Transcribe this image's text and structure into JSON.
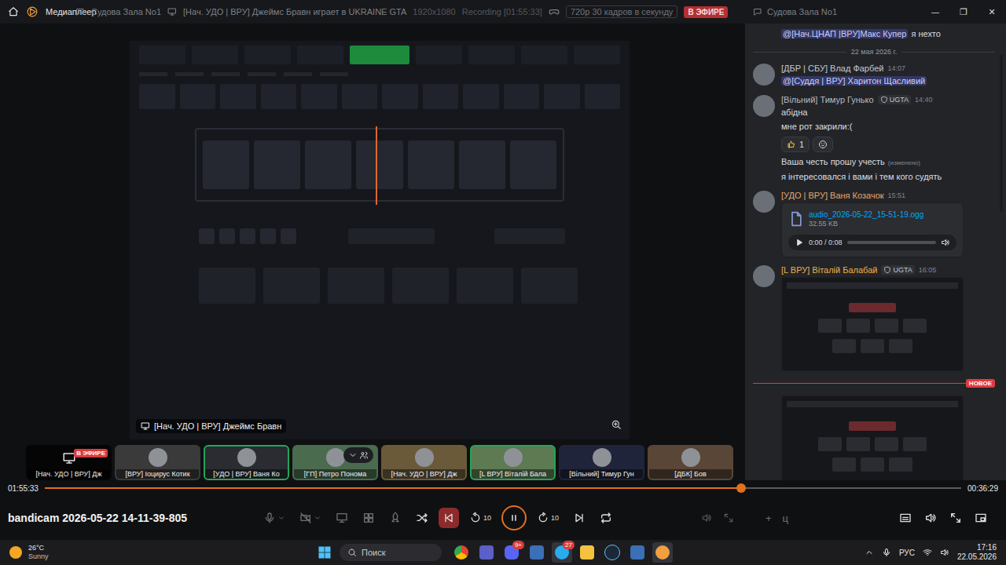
{
  "topbar": {
    "app_name": "Медиаплеер",
    "channel": "Судова Зала No1",
    "stream_title": "[Нач. УДО | ВРУ] Джеймс Бравн играет в UKRAINE GTA",
    "resolution": "1920x1080",
    "recording": "Recording [01:55:33]",
    "quality": "720p 30 кадров в секунду",
    "live_badge": "В ЭФИРЕ",
    "chat_channel": "Судова Зала No1"
  },
  "window_controls": [
    "—",
    "❐",
    "✕"
  ],
  "stream": {
    "streamer": "[Нач. УДО | ВРУ] Джеймс Бравн"
  },
  "participants": [
    {
      "kind": "stream",
      "name": "[Нач. УДО | ВРУ] Дж",
      "badge": "В ЭФИРЕ",
      "speaking": false
    },
    {
      "kind": "user",
      "name": "[ВРУ] Іоцирус Котик",
      "badge": "",
      "speaking": false
    },
    {
      "kind": "user",
      "name": "[УДО | ВРУ] Ваня Ко",
      "badge": "",
      "speaking": true
    },
    {
      "kind": "user",
      "name": "[ГП] Петро Понома",
      "badge": "",
      "speaking": false
    },
    {
      "kind": "user",
      "name": "[Нач. УДО | ВРУ] Дж",
      "badge": "",
      "speaking": false
    },
    {
      "kind": "user",
      "name": "[L ВРУ] Віталій Бала",
      "badge": "",
      "speaking": true
    },
    {
      "kind": "user",
      "name": "[Вільний] Тимур Гун",
      "badge": "",
      "speaking": false
    },
    {
      "kind": "user",
      "name": "[ДБК] Бов",
      "badge": "",
      "speaking": false
    }
  ],
  "chat": {
    "items": [
      {
        "kind": "continuation",
        "blocks": [
          {
            "kind": "line",
            "mention": "@[Нач.ЦНАП |ВРУ]Макс Купер",
            "text": "я нехто",
            "edited": ""
          }
        ]
      },
      {
        "kind": "divider",
        "text": "22 мая 2026 г."
      },
      {
        "kind": "message",
        "author": "[ДБР | СБУ] Влад Фарбей",
        "badge": "",
        "time": "14:07",
        "color": "#c4c9ce",
        "blocks": [
          {
            "kind": "line",
            "mention": "@[Суддя | ВРУ] Харитон Щасливий",
            "text": "",
            "edited": ""
          }
        ]
      },
      {
        "kind": "message",
        "author": "[Вільний] Тимур Гунько",
        "badge": "UGTA",
        "time": "14:40",
        "color": "#b8bcc2",
        "blocks": [
          {
            "kind": "line",
            "mention": "",
            "text": "абідна",
            "edited": ""
          },
          {
            "kind": "line",
            "mention": "",
            "text": "мне рот закрили:(",
            "edited": ""
          },
          {
            "kind": "reactions",
            "items": [
              {
                "count": "1",
                "selected": false
              }
            ]
          },
          {
            "kind": "line",
            "mention": "",
            "text": "Ваша честь прошу учесть",
            "edited": "(изменено)"
          },
          {
            "kind": "line",
            "mention": "",
            "text": "я інтересовался і вами і тем кого судять",
            "edited": ""
          }
        ]
      },
      {
        "kind": "message",
        "author": "[УДО | ВРУ] Ваня Козачок",
        "badge": "",
        "time": "15:51",
        "color": "#e8a66a",
        "blocks": [
          {
            "kind": "audio",
            "file": "audio_2026-05-22_15-51-19.ogg",
            "size": "32.55 KB",
            "time": "0:00 / 0:08",
            "level": 0
          }
        ]
      },
      {
        "kind": "message",
        "author": "[L ВРУ] Віталій Балабай",
        "badge": "UGTA",
        "time": "16:05",
        "color": "#f0b04a",
        "blocks": [
          {
            "kind": "image"
          }
        ]
      },
      {
        "kind": "new-divider",
        "text": "НОВОЕ"
      },
      {
        "kind": "continuation",
        "blocks": [
          {
            "kind": "image"
          }
        ]
      }
    ]
  },
  "player": {
    "elapsed": "01:55:33",
    "remaining": "00:36:29",
    "level": 0.76,
    "file": "bandicam 2026-05-22 14-11-39-805",
    "playing": true,
    "skip": "10"
  },
  "chat_input": {
    "plus": "+",
    "text": "ц"
  },
  "taskbar": {
    "weather": {
      "temp": "26°C",
      "condition": "Sunny"
    },
    "search": "Поиск",
    "apps": [
      {
        "kind": "chrome",
        "badge": "",
        "active": false
      },
      {
        "kind": "teams",
        "badge": "",
        "active": false
      },
      {
        "kind": "discord",
        "badge": "9+",
        "active": false
      },
      {
        "kind": "vs",
        "badge": "",
        "active": false
      },
      {
        "kind": "telegram",
        "badge": "27",
        "active": true
      },
      {
        "kind": "folder",
        "badge": "",
        "active": false
      },
      {
        "kind": "steam",
        "badge": "",
        "active": false
      },
      {
        "kind": "vs",
        "badge": "",
        "active": false
      },
      {
        "kind": "player",
        "badge": "",
        "active": true
      }
    ],
    "lang": "РУС",
    "time": "17:16",
    "date": "22.05.2026"
  }
}
